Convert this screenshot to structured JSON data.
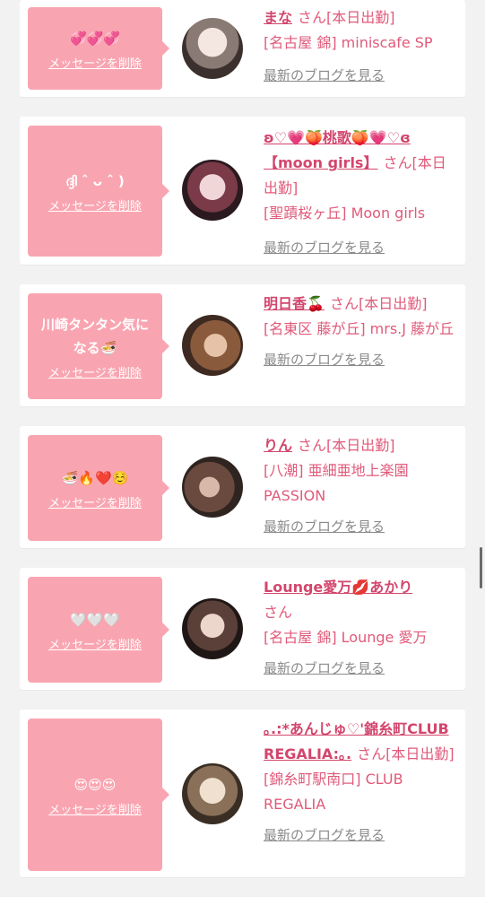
{
  "colors": {
    "bubble": "#f9a5b1",
    "name": "#d2466d",
    "text": "#e05a7a",
    "link_gray": "#8a8a8a",
    "card_bg": "#ffffff",
    "page_bg": "#f2f2f2"
  },
  "delete_label": "メッセージを削除",
  "blog_label": "最新のブログを見る",
  "san_label": "さん",
  "entries": [
    {
      "message": "💞💞💞",
      "name": "まな",
      "status": "[本日出勤]",
      "shop": "[名古屋 錦] miniscafe SP",
      "avatar_icon": "avatar-photo"
    },
    {
      "message": "ദ്ദി ˆ ᴗ ˆ )",
      "name": "ʚ♡💗🍑桃歌🍑💗♡ɞ【moon girls】",
      "status": "[本日出勤]",
      "shop": "[聖蹟桜ヶ丘] Moon girls",
      "avatar_icon": "avatar-photo"
    },
    {
      "message": "川崎タンタン気になる🍜",
      "name": "明日香🍒",
      "status": "[本日出勤]",
      "shop": "[名東区 藤が丘] mrs.J 藤が丘",
      "avatar_icon": "avatar-photo"
    },
    {
      "message": "🍜🔥❤️☺️",
      "name": "りん",
      "status": "[本日出勤]",
      "shop": "[八潮] 亜細亜地上楽園PASSION",
      "avatar_icon": "avatar-photo"
    },
    {
      "message": "🤍🤍🤍",
      "name": "Lounge愛万💋あかり",
      "status": "",
      "shop": "[名古屋 錦] Lounge 愛万",
      "avatar_icon": "avatar-photo"
    },
    {
      "message": "😍😍😍",
      "name": "｡.:*あんじゅ♡'錦糸町CLUB REGALIA:｡.",
      "status": "[本日出勤]",
      "shop": "[錦糸町駅南口] CLUB REGALIA",
      "avatar_icon": "avatar-photo"
    }
  ]
}
